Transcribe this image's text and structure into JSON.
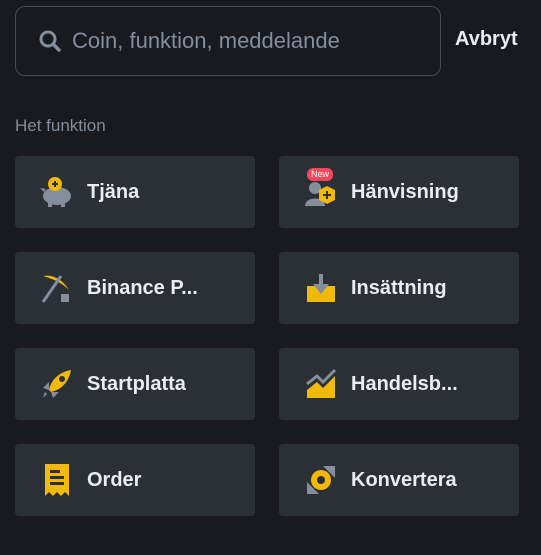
{
  "search": {
    "placeholder": "Coin, funktion, meddelande",
    "value": ""
  },
  "cancel_label": "Avbryt",
  "section_title": "Het funktion",
  "badge_new": "New",
  "cards": [
    {
      "label": "Tjäna",
      "icon": "piggy-bank-icon"
    },
    {
      "label": "Hänvisning",
      "icon": "referral-user-icon"
    },
    {
      "label": "Binance P...",
      "icon": "pickaxe-icon"
    },
    {
      "label": "Insättning",
      "icon": "deposit-icon"
    },
    {
      "label": "Startplatta",
      "icon": "rocket-icon"
    },
    {
      "label": "Handelsb...",
      "icon": "trading-chart-icon"
    },
    {
      "label": "Order",
      "icon": "receipt-icon"
    },
    {
      "label": "Konvertera",
      "icon": "convert-icon"
    }
  ],
  "colors": {
    "background": "#181a20",
    "card": "#2b2f36",
    "accent": "#f0b90b",
    "muted": "#848e9c",
    "icon_gray": "#848e9c",
    "badge": "#f6465d"
  }
}
